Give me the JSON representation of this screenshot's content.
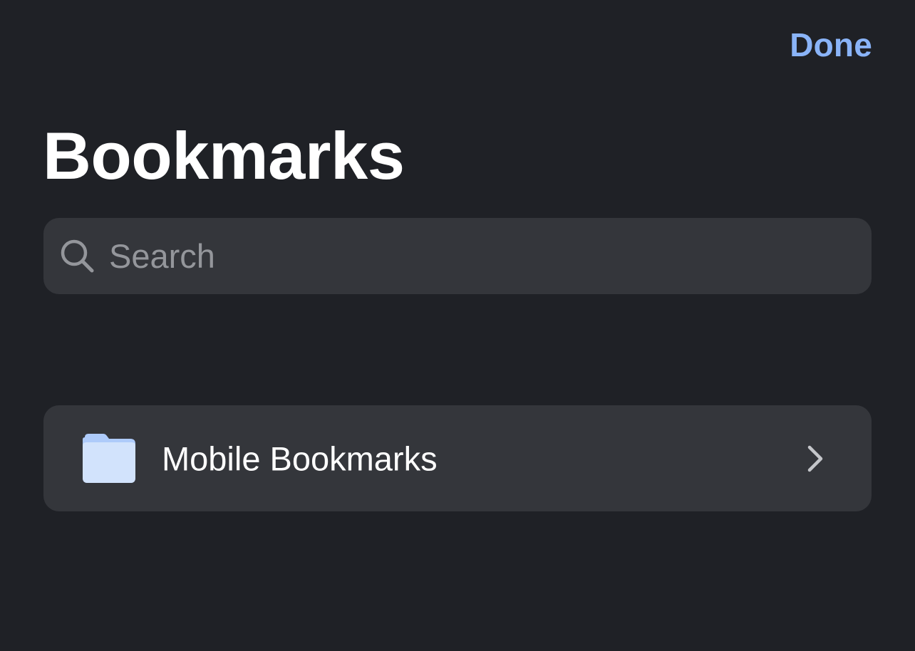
{
  "header": {
    "done_label": "Done",
    "title": "Bookmarks"
  },
  "search": {
    "placeholder": "Search",
    "value": "",
    "icon": "search-icon"
  },
  "list": {
    "items": [
      {
        "label": "Mobile Bookmarks",
        "icon": "folder-icon",
        "trailing_icon": "chevron-right-icon"
      }
    ]
  },
  "colors": {
    "background": "#1f2126",
    "surface": "#34363b",
    "accent": "#8ab4f8",
    "folder": "#d2e3fc",
    "placeholder": "#94969b"
  }
}
